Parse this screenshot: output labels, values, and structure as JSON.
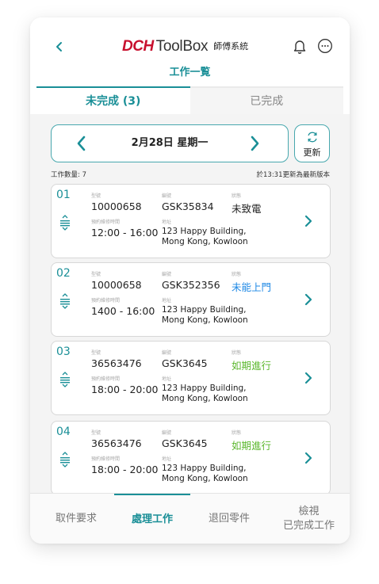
{
  "header": {
    "back_icon": "chevron-left-icon",
    "brand_dch": "DCH",
    "brand_toolbox": "ToolBox",
    "brand_subtitle": "師傅系統",
    "bell_icon": "bell-icon",
    "more_icon": "more-horizontal-icon",
    "title": "工作一覧"
  },
  "tabs": [
    {
      "label": "未完成 (3)",
      "active": true
    },
    {
      "label": "已完成",
      "active": false
    }
  ],
  "date_nav": {
    "date": "2月28日 星期一",
    "refresh_label": "更新"
  },
  "summary": {
    "count": "工作數量: 7",
    "updated": "於13:31更新為最新版本"
  },
  "field_labels": {
    "model": "型號",
    "code": "編號",
    "status": "狀態",
    "time": "預約維修時間",
    "address": "地址"
  },
  "jobs": [
    {
      "num": "01",
      "model": "10000658",
      "code": "GSK35834",
      "status": "未致電",
      "time": "12:00 - 16:00",
      "addr1": "123 Happy Building,",
      "addr2": "Mong Kong, Kowloon"
    },
    {
      "num": "02",
      "model": "10000658",
      "code": "GSK352356",
      "status": "未能上門",
      "time": "1400 - 16:00",
      "addr1": "123 Happy Building,",
      "addr2": "Mong Kong, Kowloon"
    },
    {
      "num": "03",
      "model": "36563476",
      "code": "GSK3645",
      "status": "如期進行",
      "time": "18:00 - 20:00",
      "addr1": "123 Happy Building,",
      "addr2": "Mong Kong, Kowloon"
    },
    {
      "num": "04",
      "model": "36563476",
      "code": "GSK3645",
      "status": "如期進行",
      "time": "18:00 - 20:00",
      "addr1": "123 Happy Building,",
      "addr2": "Mong Kong, Kowloon"
    }
  ],
  "status_colors": {
    "default": "#222222",
    "blue": "#1e88e5",
    "green": "#5cb82e"
  },
  "bottom_nav": [
    {
      "label": "取件要求",
      "active": false
    },
    {
      "label": "處理工作",
      "active": true
    },
    {
      "label": "退回零件",
      "active": false
    },
    {
      "label_line1": "檢視",
      "label_line2": "已完成工作",
      "active": false
    }
  ],
  "colors": {
    "accent": "#1a8f97",
    "brand_red": "#c8102e"
  }
}
